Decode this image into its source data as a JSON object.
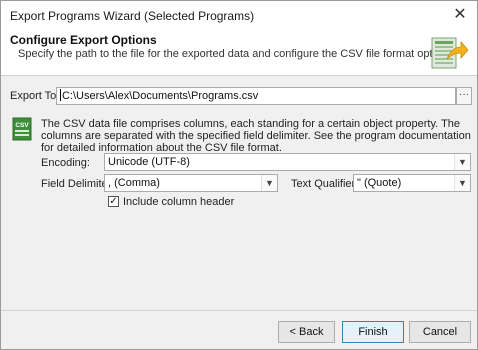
{
  "window": {
    "title": "Export Programs Wizard (Selected Programs)",
    "close_glyph": "✕"
  },
  "header": {
    "title": "Configure Export Options",
    "description": "Specify the path to the file for the exported data and configure the CSV file format options.",
    "icon": "export-document-icon"
  },
  "export_to": {
    "label": "Export To:",
    "value": "C:\\Users\\Alex\\Documents\\Programs.csv",
    "browse_label": "···"
  },
  "csv_info": {
    "icon": "csv-file-icon",
    "icon_text": "CSV",
    "text": "The CSV data file comprises columns, each standing for a certain object property. The columns are separated with the specified field delimiter. See the program documentation for detailed information about the CSV file format."
  },
  "encoding": {
    "label": "Encoding:",
    "value": "Unicode (UTF-8)"
  },
  "field_delimiter": {
    "label": "Field Delimiter:",
    "value": ", (Comma)"
  },
  "text_qualifier": {
    "label": "Text Qualifier:",
    "value": "\" (Quote)"
  },
  "include_header": {
    "label": "Include column header",
    "checked": true,
    "check_glyph": "✓"
  },
  "dropdown_arrow": "▼",
  "buttons": {
    "back": "< Back",
    "finish": "Finish",
    "cancel": "Cancel"
  },
  "colors": {
    "accent": "#3c7fb1",
    "csv_icon_green": "#3f8f3a",
    "header_icon_arrow": "#f2b21d"
  }
}
